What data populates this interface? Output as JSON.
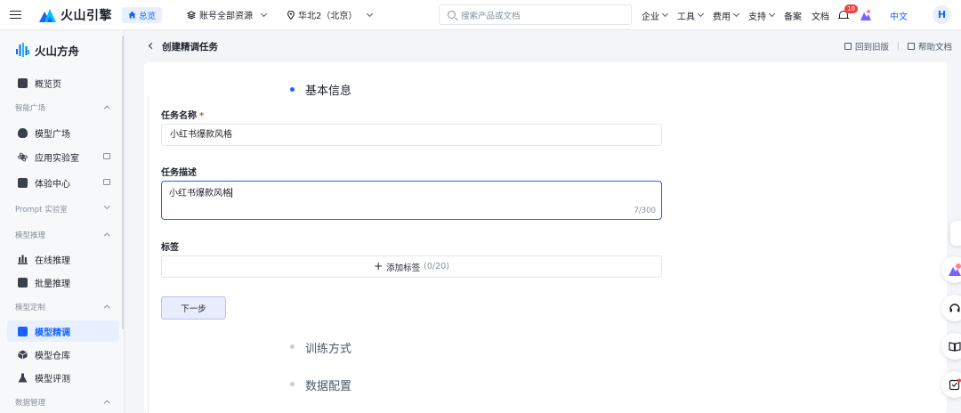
{
  "topbar": {
    "brand": "火山引擎",
    "home": "总览",
    "account_scope": "账号全部资源",
    "region": "华北2（北京）",
    "search_placeholder": "搜索产品或文档",
    "menu": [
      "企业",
      "工具",
      "费用",
      "支持"
    ],
    "filing": "备案",
    "docs": "文档",
    "notification_count": "10",
    "language": "中文",
    "avatar_initial": "H"
  },
  "sidebar": {
    "logo": "火山方舟",
    "overview": "概览页",
    "groups": {
      "smart_square": "智能广场",
      "prompt_lab": "Prompt 实验室",
      "model_inference": "模型推理",
      "model_custom": "模型定制",
      "data_mgmt": "数据管理"
    },
    "items": {
      "model_square": "模型广场",
      "app_lab": "应用实验室",
      "experience": "体验中心",
      "online_inference": "在线推理",
      "batch_inference": "批量推理",
      "finetune": "模型精调",
      "repository": "模型仓库",
      "evaluation": "模型评测"
    }
  },
  "page": {
    "title": "创建精调任务",
    "back_to_old": "回到旧版",
    "help_docs": "帮助文档"
  },
  "form": {
    "step1": "基本信息",
    "task_name_label": "任务名称",
    "required_mark": "*",
    "task_name_value": "小红书爆款风格",
    "task_desc_label": "任务描述",
    "task_desc_value": "小红书爆款风格",
    "task_desc_count": "7/300",
    "tags_label": "标签",
    "add_tag": "添加标签",
    "add_tag_count": "(0/20)",
    "next": "下一步",
    "step2": "训练方式",
    "step3": "数据配置"
  },
  "colors": {
    "accent": "#1664ff",
    "active_bg": "#e8f0ff",
    "badge": "#f53f3f"
  }
}
